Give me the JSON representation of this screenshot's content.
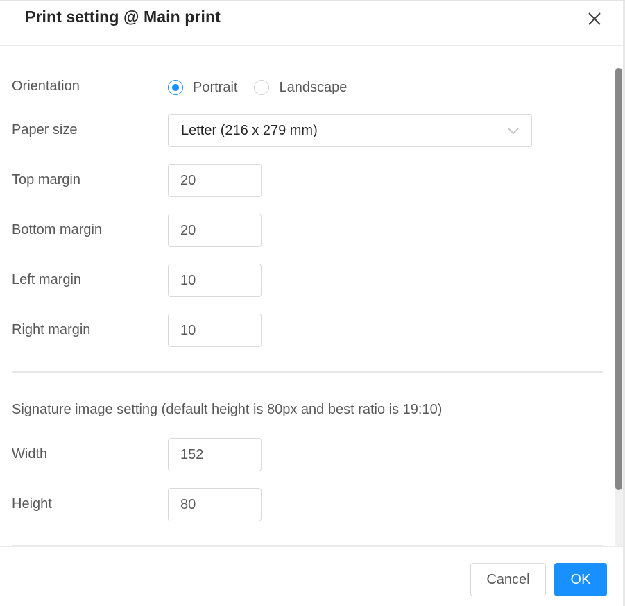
{
  "dialog": {
    "title": "Print setting @ Main print",
    "close_icon": "close-icon"
  },
  "form": {
    "orientation": {
      "label": "Orientation",
      "options": [
        {
          "label": "Portrait",
          "checked": true
        },
        {
          "label": "Landscape",
          "checked": false
        }
      ]
    },
    "paper_size": {
      "label": "Paper size",
      "value": "Letter (216 x 279 mm)",
      "icon": "chevron-down-icon"
    },
    "top_margin": {
      "label": "Top margin",
      "value": "20"
    },
    "bottom_margin": {
      "label": "Bottom margin",
      "value": "20"
    },
    "left_margin": {
      "label": "Left margin",
      "value": "10"
    },
    "right_margin": {
      "label": "Right margin",
      "value": "10"
    },
    "signature": {
      "heading": "Signature image setting (default height is 80px and best ratio is 19:10)",
      "width": {
        "label": "Width",
        "value": "152"
      },
      "height": {
        "label": "Height",
        "value": "80"
      }
    }
  },
  "footer": {
    "cancel_label": "Cancel",
    "ok_label": "OK"
  },
  "colors": {
    "primary": "#1890ff",
    "text": "#595959",
    "title": "#262626",
    "border": "#d9d9d9"
  }
}
